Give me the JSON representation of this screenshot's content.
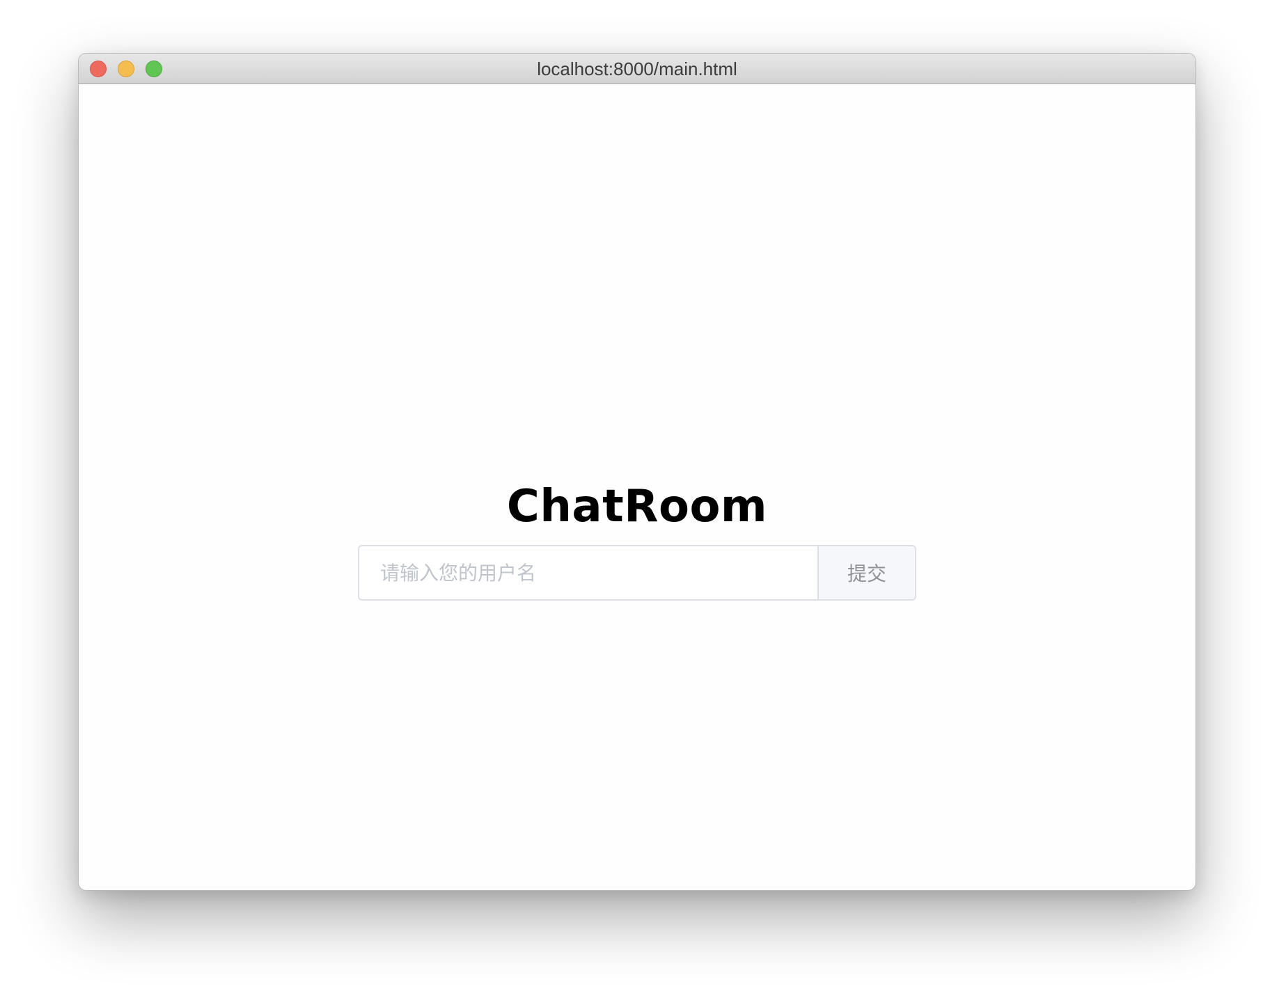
{
  "window": {
    "title": "localhost:8000/main.html"
  },
  "page": {
    "heading": "ChatRoom",
    "username_placeholder": "请输入您的用户名",
    "username_value": "",
    "submit_label": "提交"
  },
  "colors": {
    "close": "#ee6a5f",
    "minimize": "#f5bd4f",
    "maximize": "#61c554",
    "input_border": "#dcdfe6",
    "button_background": "#f5f7fa",
    "button_text": "#909399",
    "placeholder_text": "#c0c4cc"
  }
}
